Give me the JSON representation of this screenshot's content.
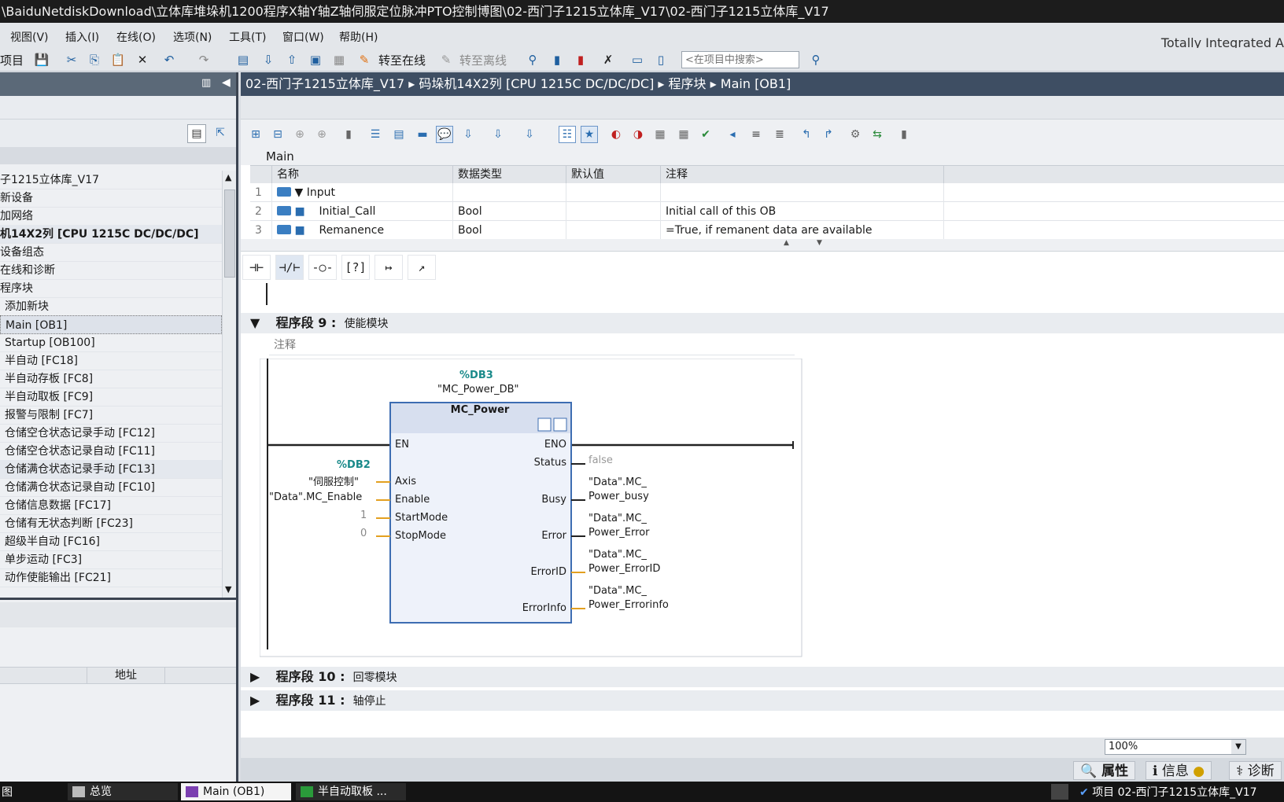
{
  "window": {
    "title": "\\BaiduNetdiskDownload\\立体库堆垛机1200程序X轴Y轴Z轴伺服定位脉冲PTO控制博图\\02-西门子1215立体库_V17\\02-西门子1215立体库_V17"
  },
  "menu": [
    "视图(V)",
    "插入(I)",
    "在线(O)",
    "选项(N)",
    "工具(T)",
    "窗口(W)",
    "帮助(H)"
  ],
  "brand": "Totally Integrated A",
  "toolbar": {
    "project_label": "项目",
    "go_online": "转至在线",
    "go_offline": "转至离线",
    "search_placeholder": "<在项目中搜索>"
  },
  "tree": {
    "items": [
      "子1215立体库_V17",
      "新设备",
      "加网络",
      "机14X2列 [CPU 1215C DC/DC/DC]",
      "设备组态",
      "在线和诊断",
      "程序块",
      "添加新块",
      "Main [OB1]",
      "Startup [OB100]",
      "半自动 [FC18]",
      "半自动存板 [FC8]",
      "半自动取板 [FC9]",
      "报警与限制 [FC7]",
      "仓储空仓状态记录手动 [FC12]",
      "仓储空仓状态记录自动 [FC11]",
      "仓储满仓状态记录手动 [FC13]",
      "仓储满仓状态记录自动 [FC10]",
      "仓储信息数据 [FC17]",
      "仓储有无状态判断 [FC23]",
      "超级半自动 [FC16]",
      "单步运动 [FC3]",
      "动作使能输出 [FC21]"
    ],
    "address_header": "地址"
  },
  "breadcrumb": [
    "02-西门子1215立体库_V17",
    "码垛机14X2列 [CPU 1215C DC/DC/DC]",
    "程序块",
    "Main [OB1]"
  ],
  "interface": {
    "title": "Main",
    "headers": [
      "名称",
      "数据类型",
      "默认值",
      "注释"
    ],
    "rows": [
      {
        "num": "1",
        "name": "Input",
        "type": "",
        "default": "",
        "comment": ""
      },
      {
        "num": "2",
        "name": "Initial_Call",
        "type": "Bool",
        "default": "",
        "comment": "Initial call of this OB"
      },
      {
        "num": "3",
        "name": "Remanence",
        "type": "Bool",
        "default": "",
        "comment": "=True, if remanent data are available"
      }
    ]
  },
  "network9": {
    "label": "程序段 9 :",
    "title": "使能模块",
    "comment_placeholder": "注释",
    "instance_db": "%DB3",
    "instance_name": "\"MC_Power_DB\"",
    "block_name": "MC_Power",
    "inputs": [
      {
        "pin": "EN",
        "db": "",
        "value": ""
      },
      {
        "pin": "Axis",
        "db": "%DB2",
        "value": "\"伺服控制\""
      },
      {
        "pin": "Enable",
        "db": "",
        "value": "\"Data\".MC_Enable"
      },
      {
        "pin": "StartMode",
        "db": "",
        "value": "1"
      },
      {
        "pin": "StopMode",
        "db": "",
        "value": "0"
      }
    ],
    "outputs": [
      {
        "pin": "ENO",
        "v1": "",
        "v2": ""
      },
      {
        "pin": "Status",
        "v1": "false",
        "v2": ""
      },
      {
        "pin": "Busy",
        "v1": "\"Data\".MC_",
        "v2": "Power_busy"
      },
      {
        "pin": "Error",
        "v1": "\"Data\".MC_",
        "v2": "Power_Error"
      },
      {
        "pin": "ErrorID",
        "v1": "\"Data\".MC_",
        "v2": "Power_ErrorID"
      },
      {
        "pin": "ErrorInfo",
        "v1": "\"Data\".MC_",
        "v2": "Power_Errorinfo"
      }
    ]
  },
  "network10": {
    "label": "程序段 10 :",
    "title": "回零模块"
  },
  "network11": {
    "label": "程序段 11 :",
    "title": "轴停止"
  },
  "zoom": "100%",
  "status_tabs": [
    "属性",
    "信息",
    "诊断"
  ],
  "taskbar": {
    "first": "图",
    "overview": "总览",
    "main": "Main (OB1)",
    "semi": "半自动取板 ...",
    "project": "项目 02-西门子1215立体库_V17"
  }
}
